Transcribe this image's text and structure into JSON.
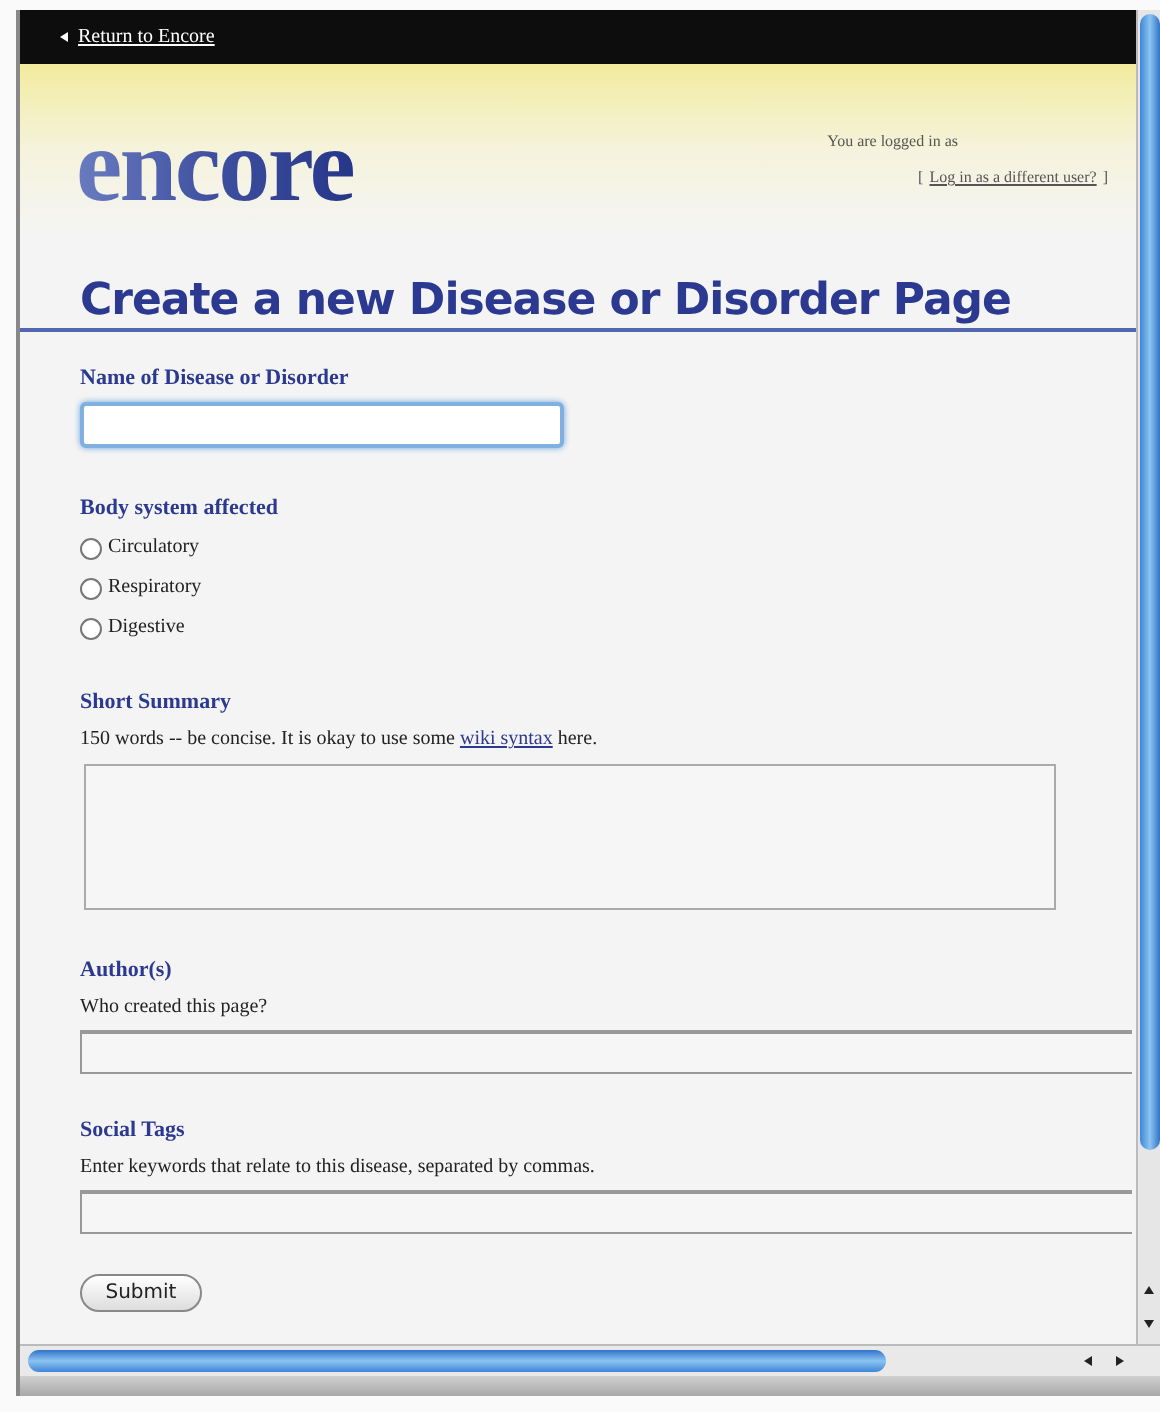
{
  "top_bar": {
    "link": "Return to Encore"
  },
  "header": {
    "logo": "encore",
    "login_status": "You are logged in as",
    "login_link": "Log in as a different user?",
    "bracket_open": "[",
    "bracket_close": "]"
  },
  "title": "Create a new Disease or Disorder Page",
  "form": {
    "name_field": {
      "label": "Name of Disease or Disorder",
      "focused": true
    },
    "body_system": {
      "label": "Body system affected",
      "options": [
        {
          "label": "Circulatory",
          "selected": false
        },
        {
          "label": "Respiratory",
          "selected": false
        },
        {
          "label": "Digestive",
          "selected": false
        }
      ]
    },
    "summary": {
      "label": "Short Summary",
      "help_before": "150 words -- be concise. It is okay to use some ",
      "help_link": "wiki syntax",
      "help_after": " here."
    },
    "authors": {
      "label": "Author(s)",
      "help": "Who created this page?"
    },
    "tags": {
      "label": "Social Tags",
      "help": "Enter keywords that relate to this disease, separated by commas."
    },
    "submit": "Submit"
  }
}
